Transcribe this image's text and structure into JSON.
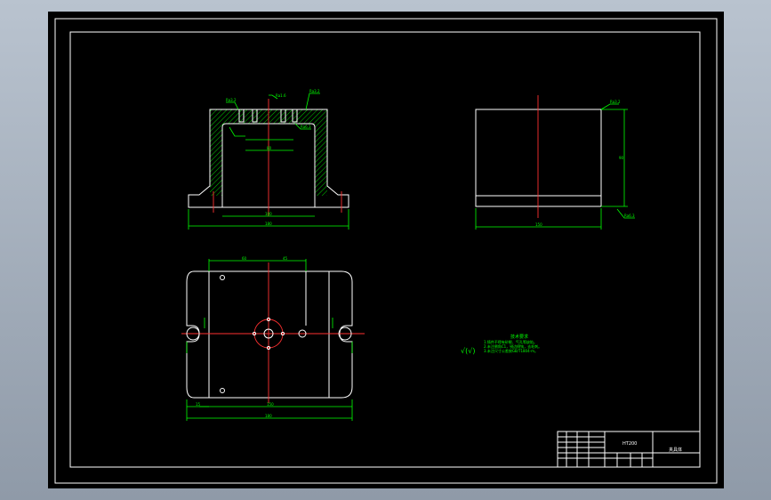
{
  "colors": {
    "background": "#000000",
    "outline": "#ffffff",
    "dimension": "#00ff00",
    "centerline": "#ff3030",
    "hatch": "#00ff00",
    "app_chrome": "#9aa5b3"
  },
  "drawing": {
    "front_view": {
      "dims": {
        "inner_width": "100",
        "overall_width": "180",
        "slot": "80"
      },
      "callouts": [
        "Ra3.2",
        "Ra1.6",
        "Ra3.2",
        "Ra6.3"
      ]
    },
    "side_view": {
      "dims": {
        "height": "90",
        "width": "150"
      },
      "callouts": [
        "Ra3.2",
        "Ra6.3"
      ]
    },
    "top_view": {
      "dims": {
        "hole_spacing_left": "60",
        "hole_spacing_right": "45",
        "width_inner": "150",
        "overall_width": "180",
        "edge": "15"
      }
    },
    "notes": {
      "heading": "技术要求",
      "lines": [
        "1.铸件不得有砂眼、气孔等缺陷。",
        "2.未注倒角C1，锐边倒钝，去毛刺。",
        "3.未注尺寸公差按GB/T1804-m。"
      ],
      "roughness_symbol": "√(√)"
    },
    "title_block": {
      "material": "HT200",
      "part_name": "夹具体"
    }
  }
}
